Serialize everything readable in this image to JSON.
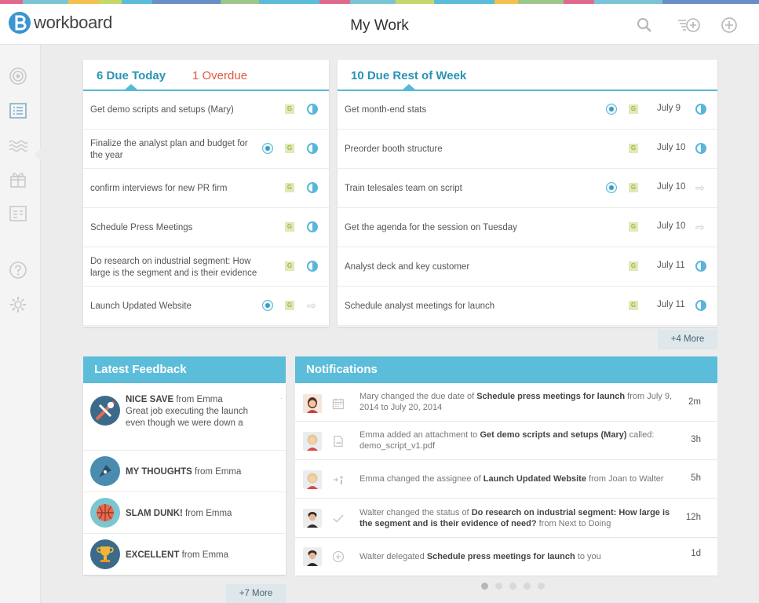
{
  "app": {
    "logo_text": "workboard",
    "title": "My Work",
    "colors": {
      "accent": "#5bbdd9",
      "overdue": "#e4573e",
      "brand": "#3a95d0"
    }
  },
  "header_icons": [
    "search-icon",
    "add-task-list-icon",
    "plus-circle-icon"
  ],
  "rail_icons": [
    "goal-target-icon",
    "my-work-list-icon",
    "stream-waves-icon",
    "gift-icon",
    "report-icon",
    "help-icon",
    "settings-gear-icon"
  ],
  "today": {
    "tab_due": "6 Due Today",
    "tab_overdue": "1 Overdue",
    "rows": [
      {
        "text": "Get demo scripts and setups (Mary)",
        "target": false,
        "goal": "G",
        "status": "half"
      },
      {
        "text": "Finalize the analyst plan and budget for the year",
        "target": true,
        "goal": "G",
        "status": "half"
      },
      {
        "text": "confirm interviews for new PR firm",
        "target": false,
        "goal": "G",
        "status": "half"
      },
      {
        "text": "Schedule Press Meetings",
        "target": false,
        "goal": "G",
        "status": "half"
      },
      {
        "text": "Do research on industrial segment: How large is the segment and is their evidence",
        "target": false,
        "goal": "G",
        "status": "half"
      },
      {
        "text": "Launch Updated Website",
        "target": true,
        "goal": "G",
        "status": "arrow"
      }
    ]
  },
  "week": {
    "tab_due": "10 Due Rest of Week",
    "more": "+4 More",
    "rows": [
      {
        "text": "Get month-end stats",
        "target": true,
        "goal": "G",
        "date": "July 9",
        "status": "half"
      },
      {
        "text": "Preorder booth structure",
        "target": false,
        "goal": "G",
        "date": "July 10",
        "status": "half"
      },
      {
        "text": "Train telesales team on script",
        "target": true,
        "goal": "G",
        "date": "July 10",
        "status": "arrow"
      },
      {
        "text": "Get the agenda for the session on Tuesday",
        "target": false,
        "goal": "G",
        "date": "July 10",
        "status": "arrow"
      },
      {
        "text": "Analyst deck and key customer",
        "target": false,
        "goal": "G",
        "date": "July 11",
        "status": "half"
      },
      {
        "text": "Schedule analyst meetings for launch",
        "target": false,
        "goal": "G",
        "date": "July 11",
        "status": "half"
      }
    ]
  },
  "feedback": {
    "title": "Latest Feedback",
    "more": "+7 More",
    "items": [
      {
        "badge": "NICE SAVE",
        "from": "from Emma",
        "body": "Great job executing the launch even though we were down a",
        "icon": "nice-save-icon"
      },
      {
        "badge": "MY THOUGHTS",
        "from": "from Emma",
        "body": "",
        "icon": "pen-nib-icon"
      },
      {
        "badge": "SLAM DUNK!",
        "from": "from Emma",
        "body": "",
        "icon": "basketball-icon"
      },
      {
        "badge": "EXCELLENT",
        "from": "from Emma",
        "body": "",
        "icon": "trophy-icon"
      }
    ]
  },
  "notifications": {
    "title": "Notifications",
    "items": [
      {
        "pre": "Mary changed the due date of ",
        "bold": "Schedule press meetings for launch",
        "post": " from July 9, 2014 to July 20, 2014",
        "time": "2m",
        "icon": "calendar-icon",
        "avatar": "mary-avatar"
      },
      {
        "pre": "Emma added an attachment to ",
        "bold": "Get demo scripts and setups (Mary)",
        "post": " called: demo_script_v1.pdf",
        "time": "3h",
        "icon": "attachment-icon",
        "avatar": "emma-avatar"
      },
      {
        "pre": "Emma changed the assignee of ",
        "bold": "Launch Updated Website",
        "post": " from Joan to Walter",
        "time": "5h",
        "icon": "assignee-icon",
        "avatar": "emma-avatar"
      },
      {
        "pre": "Walter changed the status of ",
        "bold": "Do research on industrial segment: How large is the segment and is their evidence of need?",
        "post": " from Next to Doing",
        "time": "12h",
        "icon": "checkmark-icon",
        "avatar": "walter-avatar"
      },
      {
        "pre": "Walter delegated ",
        "bold": "Schedule press meetings for launch",
        "post": " to you",
        "time": "1d",
        "icon": "plus-circle-icon",
        "avatar": "walter-avatar"
      }
    ]
  },
  "pagination": {
    "pages": 5,
    "current": 1
  }
}
